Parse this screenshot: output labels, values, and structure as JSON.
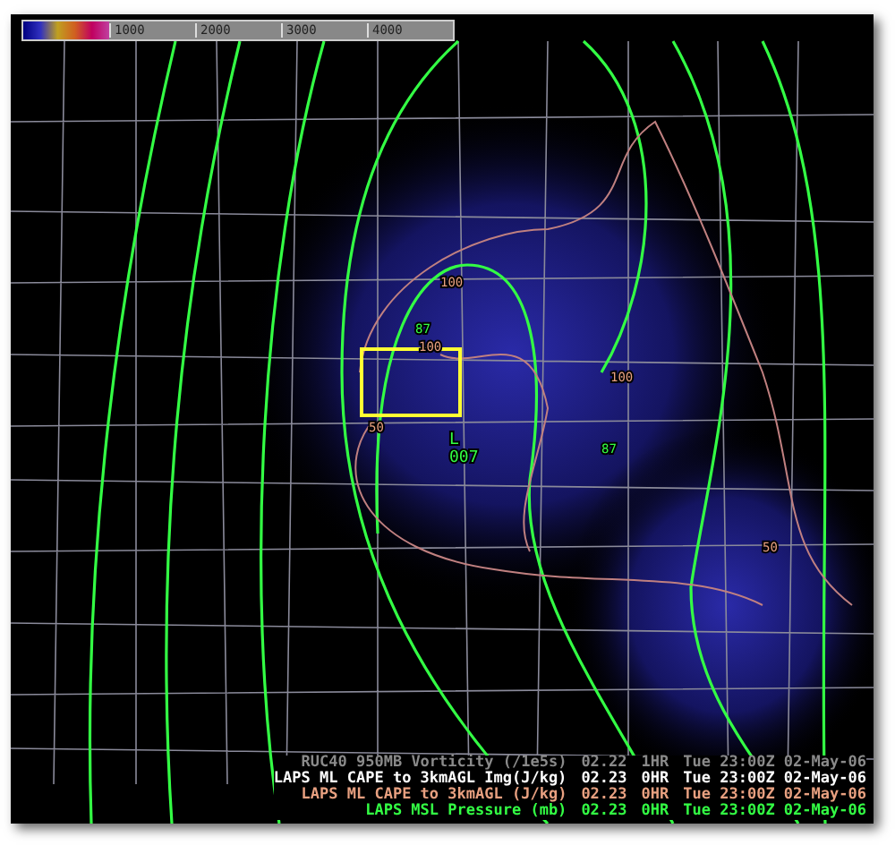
{
  "colorbar": {
    "labels": [
      "1000",
      "2000",
      "3000",
      "4000"
    ]
  },
  "map_labels": [
    {
      "kind": "isobar",
      "text": "87"
    },
    {
      "kind": "isobar",
      "text": "87"
    },
    {
      "kind": "cape",
      "text": "100"
    },
    {
      "kind": "cape",
      "text": "100"
    },
    {
      "kind": "cape",
      "text": "100"
    },
    {
      "kind": "cape",
      "text": "50"
    },
    {
      "kind": "cape",
      "text": "50"
    },
    {
      "kind": "low",
      "text": "L"
    },
    {
      "kind": "low",
      "text": "007"
    }
  ],
  "legend": [
    {
      "product": "RUC40 950MB Vorticity (/1e5s)",
      "value": "02.22",
      "hour": "1HR",
      "time": "Tue 23:00Z 02-May-06",
      "color": "#8a8a8a"
    },
    {
      "product": "LAPS ML CAPE to 3kmAGL Img(J/kg)",
      "value": "02.23",
      "hour": "0HR",
      "time": "Tue 23:00Z 02-May-06",
      "color": "#ffffff"
    },
    {
      "product": "LAPS ML CAPE to 3kmAGL (J/kg)",
      "value": "02.23",
      "hour": "0HR",
      "time": "Tue 23:00Z 02-May-06",
      "color": "#e8a080"
    },
    {
      "product": "LAPS MSL Pressure (mb)",
      "value": "02.23",
      "hour": "0HR",
      "time": "Tue 23:00Z 02-May-06",
      "color": "#33ff44"
    }
  ]
}
